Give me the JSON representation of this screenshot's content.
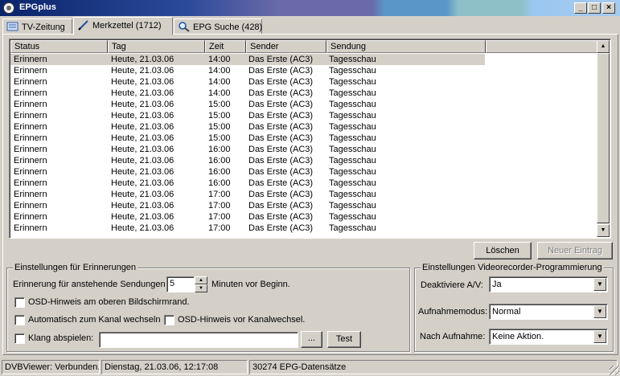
{
  "window": {
    "title": "EPGplus"
  },
  "tabs": [
    {
      "label": "TV-Zeitung"
    },
    {
      "label": "Merkzettel (1712)"
    },
    {
      "label": "EPG Suche (428)"
    }
  ],
  "list": {
    "columns": [
      "Status",
      "Tag",
      "Zeit",
      "Sender",
      "Sendung"
    ],
    "rows": [
      [
        "Erinnern",
        "Heute, 21.03.06",
        "14:00",
        "Das Erste (AC3)",
        "Tagesschau"
      ],
      [
        "Erinnern",
        "Heute, 21.03.06",
        "14:00",
        "Das Erste (AC3)",
        "Tagesschau"
      ],
      [
        "Erinnern",
        "Heute, 21.03.06",
        "14:00",
        "Das Erste (AC3)",
        "Tagesschau"
      ],
      [
        "Erinnern",
        "Heute, 21.03.06",
        "14:00",
        "Das Erste (AC3)",
        "Tagesschau"
      ],
      [
        "Erinnern",
        "Heute, 21.03.06",
        "15:00",
        "Das Erste (AC3)",
        "Tagesschau"
      ],
      [
        "Erinnern",
        "Heute, 21.03.06",
        "15:00",
        "Das Erste (AC3)",
        "Tagesschau"
      ],
      [
        "Erinnern",
        "Heute, 21.03.06",
        "15:00",
        "Das Erste (AC3)",
        "Tagesschau"
      ],
      [
        "Erinnern",
        "Heute, 21.03.06",
        "15:00",
        "Das Erste (AC3)",
        "Tagesschau"
      ],
      [
        "Erinnern",
        "Heute, 21.03.06",
        "16:00",
        "Das Erste (AC3)",
        "Tagesschau"
      ],
      [
        "Erinnern",
        "Heute, 21.03.06",
        "16:00",
        "Das Erste (AC3)",
        "Tagesschau"
      ],
      [
        "Erinnern",
        "Heute, 21.03.06",
        "16:00",
        "Das Erste (AC3)",
        "Tagesschau"
      ],
      [
        "Erinnern",
        "Heute, 21.03.06",
        "16:00",
        "Das Erste (AC3)",
        "Tagesschau"
      ],
      [
        "Erinnern",
        "Heute, 21.03.06",
        "17:00",
        "Das Erste (AC3)",
        "Tagesschau"
      ],
      [
        "Erinnern",
        "Heute, 21.03.06",
        "17:00",
        "Das Erste (AC3)",
        "Tagesschau"
      ],
      [
        "Erinnern",
        "Heute, 21.03.06",
        "17:00",
        "Das Erste (AC3)",
        "Tagesschau"
      ],
      [
        "Erinnern",
        "Heute, 21.03.06",
        "17:00",
        "Das Erste (AC3)",
        "Tagesschau"
      ]
    ]
  },
  "buttons": {
    "delete": "Löschen",
    "new_entry": "Neuer Eintrag",
    "browse": "...",
    "test": "Test"
  },
  "reminders": {
    "legend": "Einstellungen für Erinnerungen",
    "upcoming_label": "Erinnerung für anstehende Sendungen",
    "minutes_value": "5",
    "minutes_suffix": "Minuten vor Beginn.",
    "osd_top_label": "OSD-Hinweis am oberen Bildschirmrand.",
    "auto_switch_label": "Automatisch zum Kanal wechseln",
    "osd_switch_label": "OSD-Hinweis vor Kanalwechsel.",
    "sound_label": "Klang abspielen:",
    "sound_file": ""
  },
  "recorder": {
    "legend": "Einstellungen Videorecorder-Programmierung",
    "disable_av_label": "Deaktiviere A/V:",
    "disable_av_value": "Ja",
    "mode_label": "Aufnahmemodus:",
    "mode_value": "Normal",
    "after_label": "Nach Aufnahme:",
    "after_value": "Keine Aktion."
  },
  "status": {
    "connection": "DVBViewer: Verbunden.",
    "datetime": "Dienstag, 21.03.06, 12:17:08",
    "records": "30274 EPG-Datensätze"
  }
}
